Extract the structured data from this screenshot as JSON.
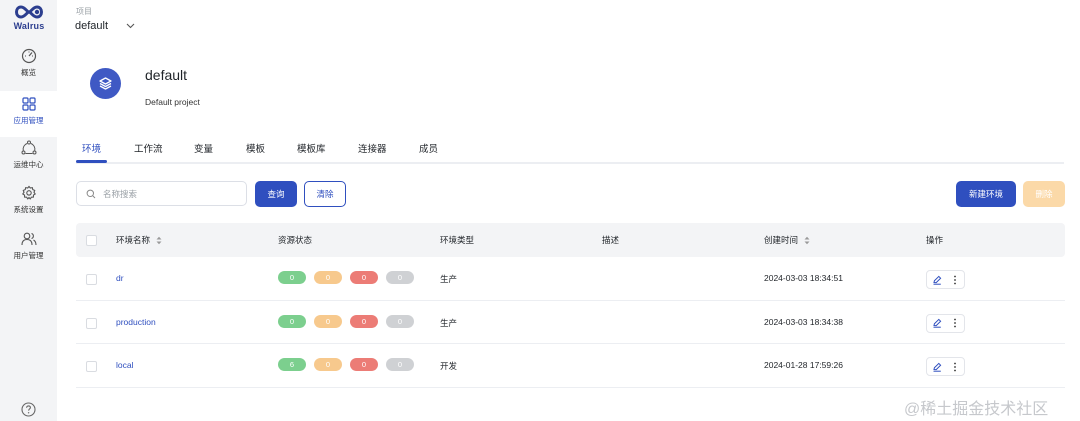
{
  "brand": {
    "name": "Walrus",
    "accent": "#2f4fbf"
  },
  "sidebar": {
    "items": [
      {
        "label": "概览",
        "icon": "dashboard-icon",
        "active": false
      },
      {
        "label": "应用管理",
        "icon": "grid-icon",
        "active": true
      },
      {
        "label": "运维中心",
        "icon": "operations-icon",
        "active": false
      },
      {
        "label": "系统设置",
        "icon": "gear-icon",
        "active": false
      },
      {
        "label": "用户管理",
        "icon": "users-icon",
        "active": false
      }
    ],
    "help_icon": "help-icon"
  },
  "header": {
    "project_caption": "项目",
    "project_selected": "default"
  },
  "project": {
    "name": "default",
    "description": "Default project"
  },
  "tabs": [
    {
      "label": "环境",
      "active": true
    },
    {
      "label": "工作流",
      "active": false
    },
    {
      "label": "变量",
      "active": false
    },
    {
      "label": "模板",
      "active": false
    },
    {
      "label": "模板库",
      "active": false
    },
    {
      "label": "连接器",
      "active": false
    },
    {
      "label": "成员",
      "active": false
    }
  ],
  "toolbar": {
    "search_placeholder": "名称搜索",
    "search_value": "",
    "query_label": "查询",
    "clear_label": "清除",
    "new_label": "新建环境",
    "delete_label": "删除"
  },
  "table": {
    "columns": {
      "name": "环境名称",
      "status": "资源状态",
      "type": "环境类型",
      "description": "描述",
      "created": "创建时间",
      "actions": "操作"
    },
    "status_colors": [
      "#7ccf8e",
      "#f7c98d",
      "#ec7c76",
      "#cfd1d4"
    ],
    "rows": [
      {
        "name": "dr",
        "status": [
          "0",
          "0",
          "0",
          "0"
        ],
        "type": "生产",
        "description": "",
        "created": "2024-03-03 18:34:51"
      },
      {
        "name": "production",
        "status": [
          "0",
          "0",
          "0",
          "0"
        ],
        "type": "生产",
        "description": "",
        "created": "2024-03-03 18:34:38"
      },
      {
        "name": "local",
        "status": [
          "6",
          "0",
          "0",
          "0"
        ],
        "type": "开发",
        "description": "",
        "created": "2024-01-28 17:59:26"
      }
    ]
  },
  "watermark": "@稀土掘金技术社区"
}
